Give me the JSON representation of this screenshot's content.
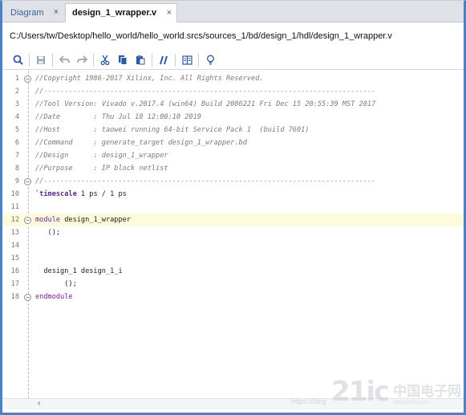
{
  "tabs": [
    {
      "label": "Diagram",
      "close": "×"
    },
    {
      "label": "design_1_wrapper.v",
      "close": "×"
    }
  ],
  "file_path": "C:/Users/tw/Desktop/hello_world/hello_world.srcs/sources_1/bd/design_1/hdl/design_1_wrapper.v",
  "toolbar": {
    "search": "search-icon",
    "save": "save-icon",
    "undo": "undo-icon",
    "redo": "redo-icon",
    "cut": "cut-icon",
    "copy": "copy-icon",
    "paste": "paste-icon",
    "comment": "comment-icon",
    "columns": "columns-icon",
    "bulb": "lightbulb-icon"
  },
  "editor": {
    "lines": [
      {
        "n": "1",
        "text": "//Copyright 1986-2017 Xilinx, Inc. All Rights Reserved.",
        "kind": "comment",
        "fold": "−"
      },
      {
        "n": "2",
        "text": "//--------------------------------------------------------------------------------",
        "kind": "comment",
        "fold": ""
      },
      {
        "n": "3",
        "text": "//Tool Version: Vivado v.2017.4 (win64) Build 2086221 Fri Dec 15 20:55:39 MST 2017",
        "kind": "comment",
        "fold": ""
      },
      {
        "n": "4",
        "text": "//Date        : Thu Jul 18 12:00:10 2019",
        "kind": "comment",
        "fold": ""
      },
      {
        "n": "5",
        "text": "//Host        : taowei running 64-bit Service Pack 1  (build 7601)",
        "kind": "comment",
        "fold": ""
      },
      {
        "n": "6",
        "text": "//Command     : generate_target design_1_wrapper.bd",
        "kind": "comment",
        "fold": ""
      },
      {
        "n": "7",
        "text": "//Design      : design_1_wrapper",
        "kind": "comment",
        "fold": ""
      },
      {
        "n": "8",
        "text": "//Purpose     : IP block netlist",
        "kind": "comment",
        "fold": ""
      },
      {
        "n": "9",
        "text": "//--------------------------------------------------------------------------------",
        "kind": "comment",
        "fold": "−"
      },
      {
        "n": "10",
        "text": "`timescale 1 ps / 1 ps",
        "kind": "directive",
        "fold": ""
      },
      {
        "n": "11",
        "text": "",
        "kind": "plain",
        "fold": ""
      },
      {
        "n": "12",
        "text": "module design_1_wrapper",
        "kind": "module",
        "fold": "−"
      },
      {
        "n": "13",
        "text": "   ();",
        "kind": "plain",
        "fold": ""
      },
      {
        "n": "14",
        "text": "",
        "kind": "plain",
        "fold": ""
      },
      {
        "n": "15",
        "text": "",
        "kind": "plain",
        "fold": ""
      },
      {
        "n": "16",
        "text": "  design_1 design_1_i",
        "kind": "plain",
        "fold": ""
      },
      {
        "n": "17",
        "text": "       ();",
        "kind": "plain",
        "fold": ""
      },
      {
        "n": "18",
        "text": "endmodule",
        "kind": "endmodule",
        "fold": "−"
      }
    ],
    "highlighted_line": "12"
  },
  "scroll_left_arrow": "‹",
  "watermark": {
    "url": "https://blog",
    "logo": "21ic",
    "cn_big": "中国电子网",
    "cn_small": "www.21ic.com"
  }
}
